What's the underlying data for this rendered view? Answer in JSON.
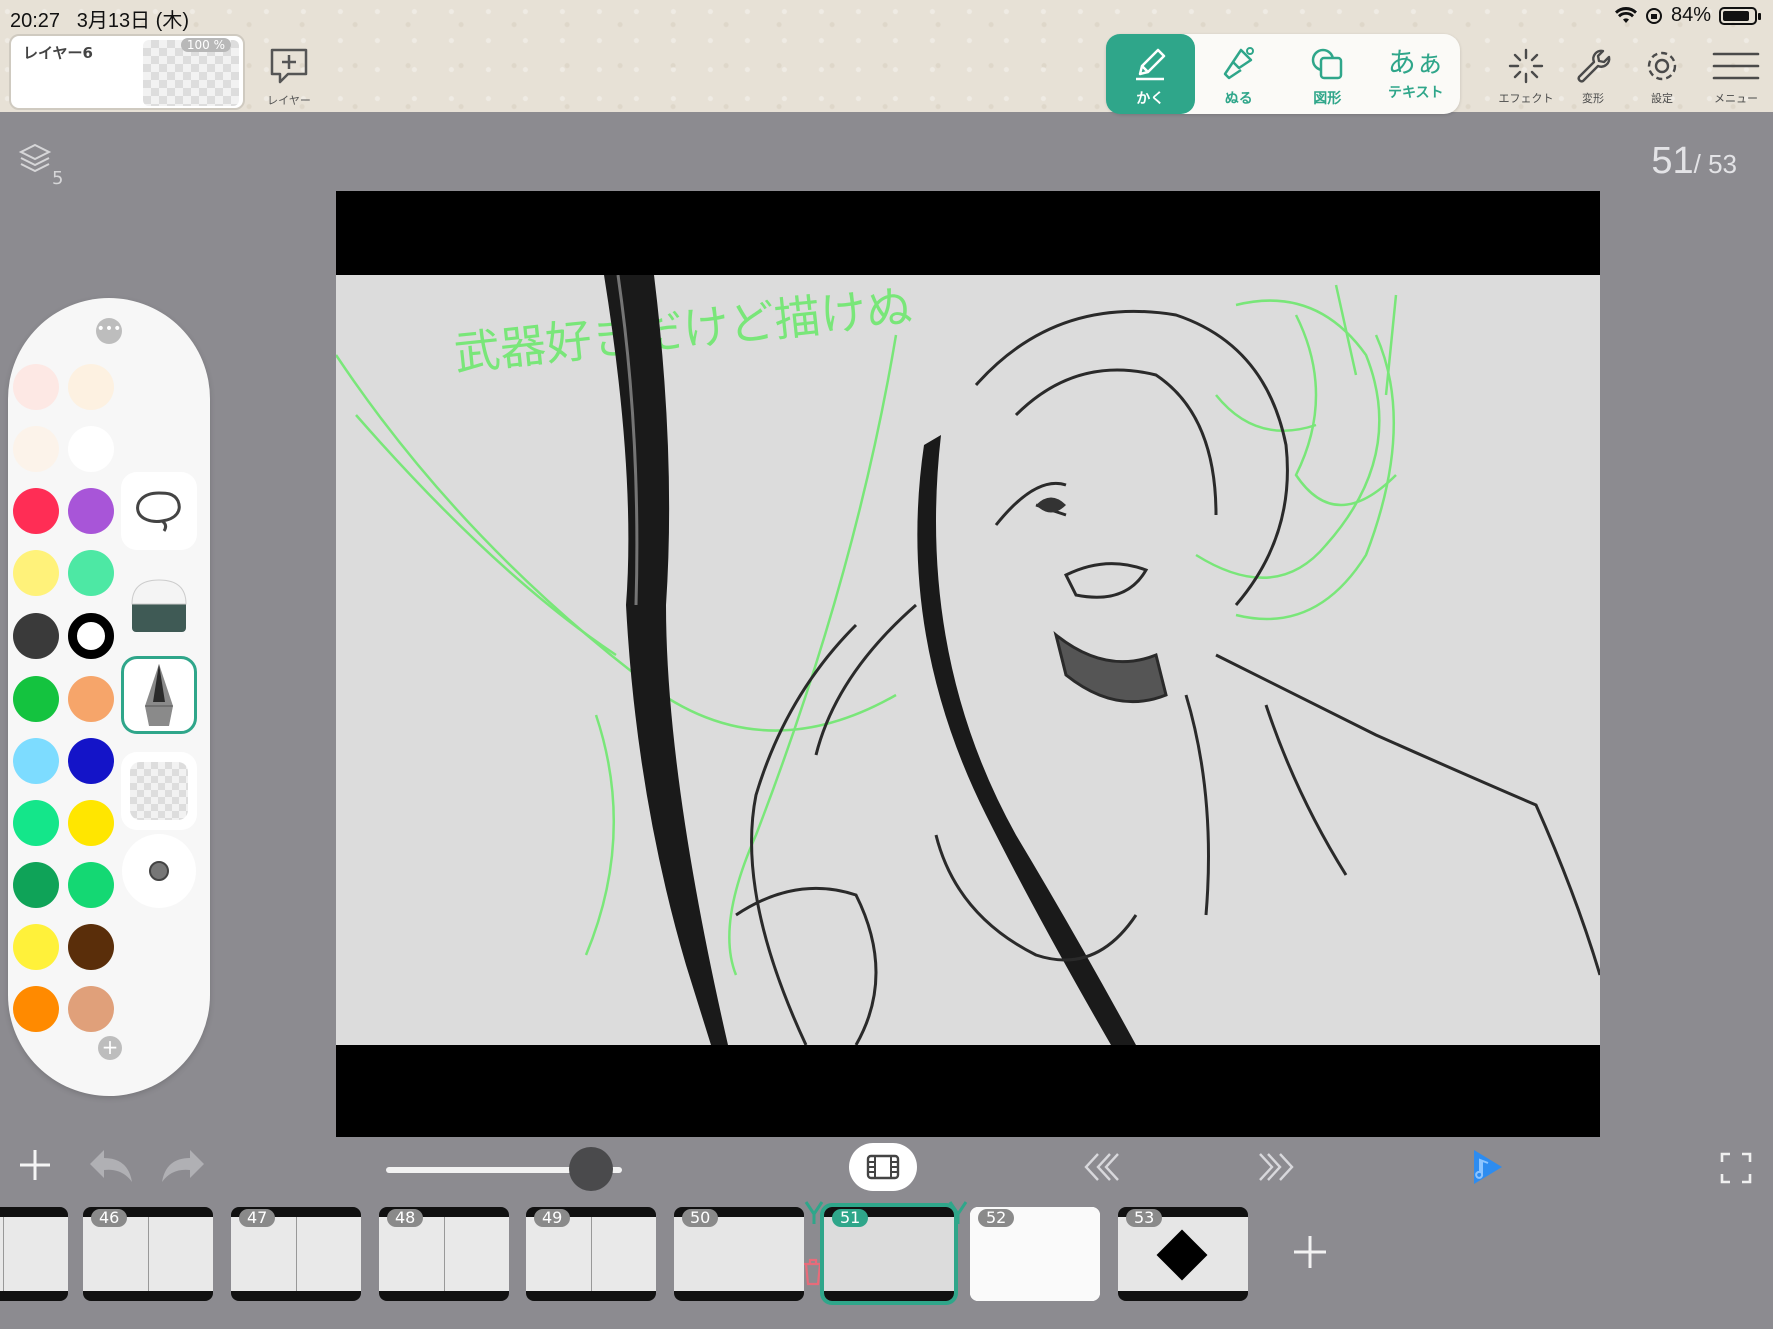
{
  "status": {
    "time": "20:27",
    "date": "3月13日 (木)",
    "battery": "84%"
  },
  "layer": {
    "name": "レイヤー6",
    "opacity": "100 %",
    "add_label": "レイヤー",
    "count": "5"
  },
  "tools": [
    {
      "label": "かく",
      "icon": "pencil-icon"
    },
    {
      "label": "ぬる",
      "icon": "fill-brush-icon"
    },
    {
      "label": "図形",
      "icon": "shape-icon"
    },
    {
      "label": "テキスト",
      "icon_text": "あぁ"
    }
  ],
  "right_tools": [
    {
      "label": "エフェクト",
      "icon": "sparkle-icon"
    },
    {
      "label": "変形",
      "icon": "wrench-icon"
    },
    {
      "label": "設定",
      "icon": "gear-icon"
    },
    {
      "label": "メニュー",
      "icon": "menu-icon"
    }
  ],
  "frame_counter": {
    "current": "51",
    "total": "/ 53"
  },
  "canvas_text": "武器好きだけど描けぬ",
  "palette": {
    "colors": [
      "#fde8e4",
      "#fdf1e1",
      "#fcf3ea",
      "#ffffff",
      "#ff2d55",
      "#a855d8",
      "#fff27a",
      "#4de8a4",
      "#3a3a3a",
      "#ffffff",
      "#14c33f",
      "#f6a56a",
      "#7ddcff",
      "#1414c8",
      "#14e68a",
      "#ffe600",
      "#0fa358",
      "#14d873",
      "#fff13a",
      "#5a2e0a",
      "#ff8a00",
      "#e0a07a"
    ],
    "brushes": [
      "lasso-icon",
      "eraser-icon",
      "pen-nib-icon",
      "transparent-icon",
      "dot-brush-icon"
    ],
    "active_brush": 2
  },
  "playback": {
    "brush_size": 0.87
  },
  "frames": [
    {
      "num": "",
      "partial": true
    },
    {
      "num": "46"
    },
    {
      "num": "47"
    },
    {
      "num": "48"
    },
    {
      "num": "49"
    },
    {
      "num": "50"
    },
    {
      "num": "51"
    },
    {
      "num": "52"
    },
    {
      "num": "53"
    }
  ]
}
